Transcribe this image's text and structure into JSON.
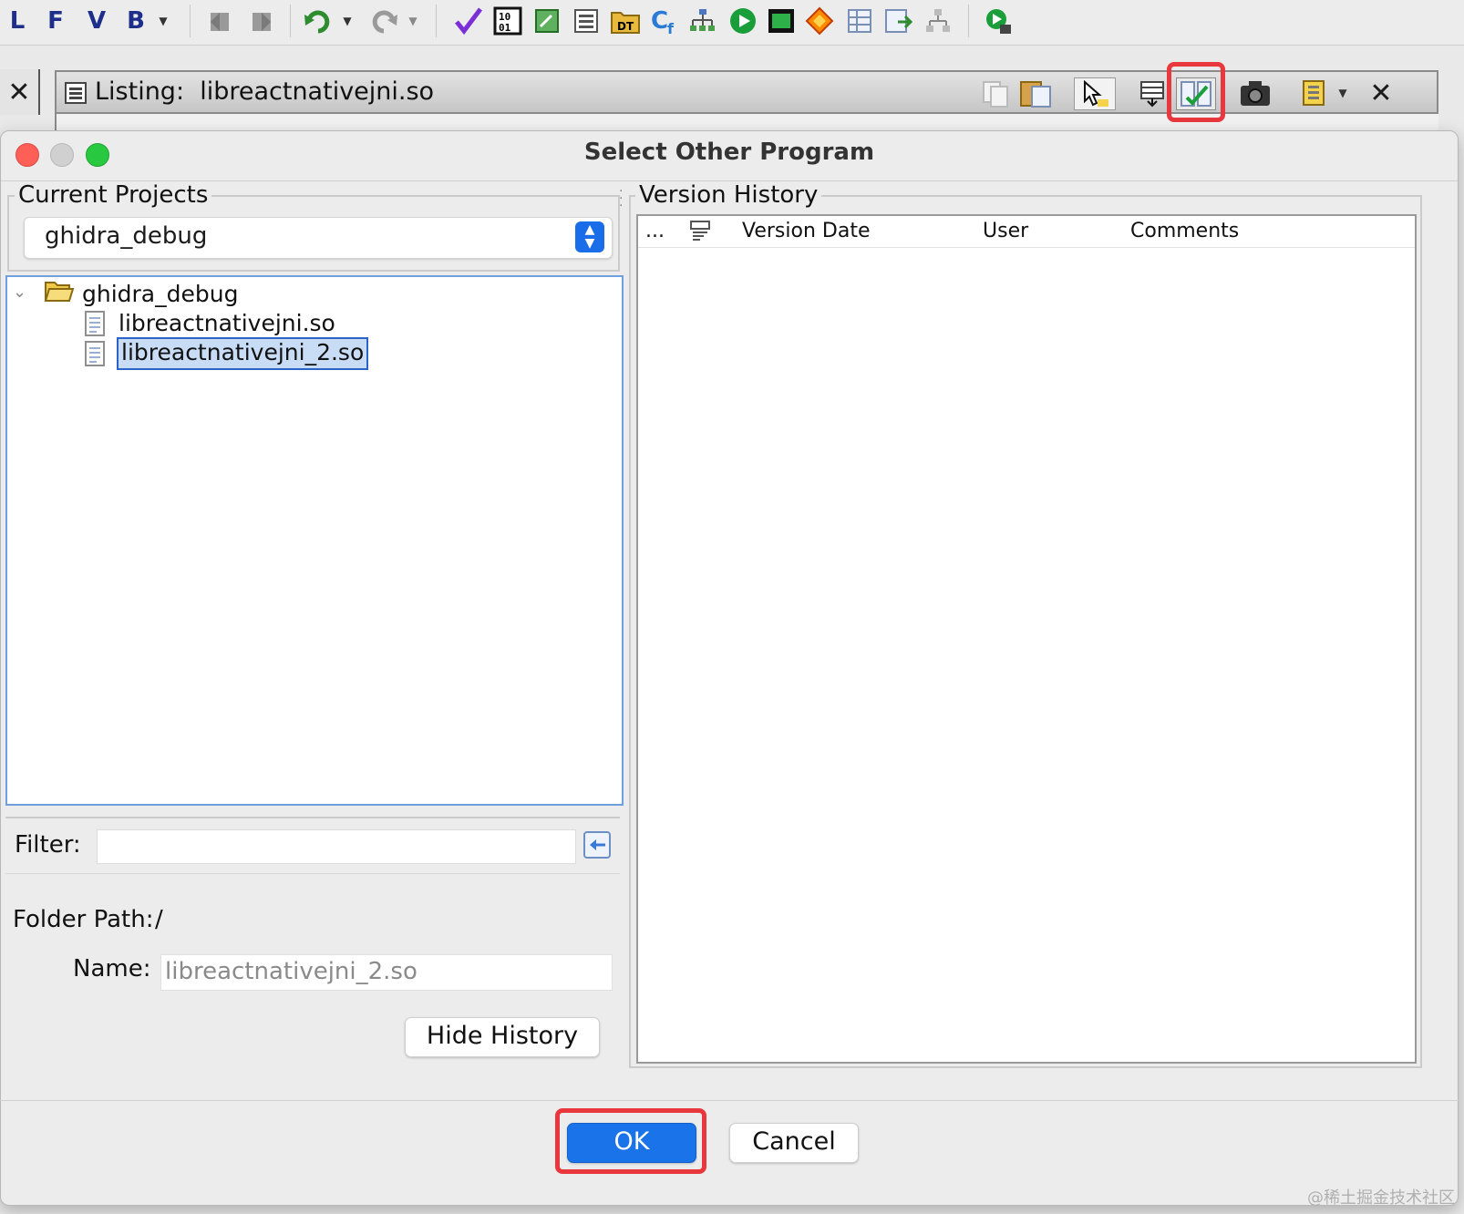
{
  "toolbar": {
    "letters": [
      "L",
      "F",
      "V",
      "B"
    ]
  },
  "listing": {
    "title": "Listing:  libreactnativejni.so",
    "close_glyph": "✕"
  },
  "dialog": {
    "title": "Select Other Program",
    "current_projects": {
      "label": "Current Projects",
      "selected": "ghidra_debug"
    },
    "tree": {
      "root": "ghidra_debug",
      "files": [
        "libreactnativejni.so",
        "libreactnativejni_2.so"
      ],
      "selected_file": "libreactnativejni_2.so"
    },
    "filter": {
      "label": "Filter:",
      "value": ""
    },
    "folder_path": {
      "label": "Folder Path:",
      "value": "/"
    },
    "name": {
      "label": "Name:",
      "value": "libreactnativejni_2.so"
    },
    "hide_history_label": "Hide History",
    "version_history": {
      "label": "Version History",
      "columns": [
        "...",
        "Version Date",
        "User",
        "Comments"
      ]
    },
    "ok_label": "OK",
    "cancel_label": "Cancel"
  },
  "watermark": "@稀土掘金技术社区",
  "colors": {
    "accent": "#1a73e8",
    "highlight_box": "#e8383d",
    "selection": "#c9dcf6"
  }
}
